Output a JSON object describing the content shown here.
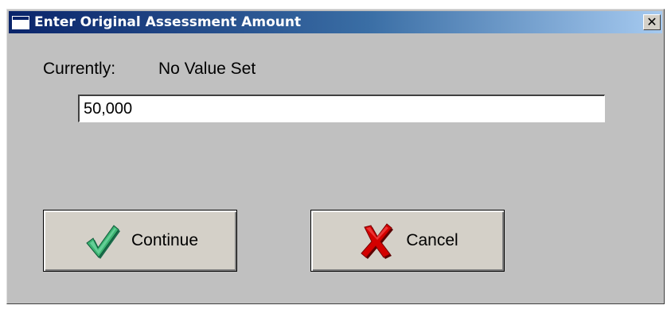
{
  "window": {
    "title": "Enter Original Assessment Amount",
    "close_label": "×"
  },
  "form": {
    "currently_label": "Currently:",
    "currently_value": "No Value Set",
    "amount_value": "50,000"
  },
  "buttons": {
    "continue_label": "Continue",
    "cancel_label": "Cancel"
  },
  "icons": {
    "window_icon": "window-icon",
    "continue_icon": "checkmark-icon",
    "cancel_icon": "red-x-icon"
  },
  "colors": {
    "titlebar_start": "#0a246a",
    "titlebar_end": "#a6caf0",
    "dialog_bg": "#c0c0c0",
    "check_color": "#2e8b57",
    "cancel_color": "#cc0000"
  }
}
